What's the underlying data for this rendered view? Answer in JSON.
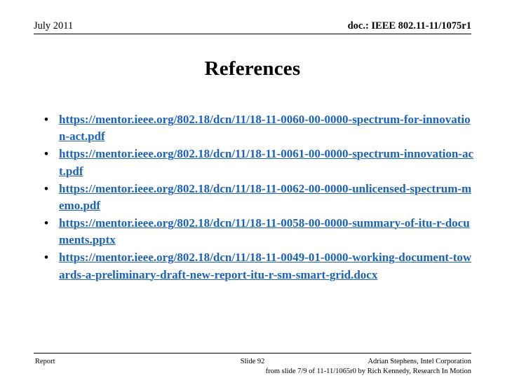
{
  "header": {
    "date": "July 2011",
    "doc": "doc.: IEEE 802.11-11/1075r1"
  },
  "title": "References",
  "bullets": [
    {
      "marker": "•",
      "link": "https://mentor.ieee.org/802.18/dcn/11/18-11-0060-00-0000-spectrum-for-innovation-act.pdf"
    },
    {
      "marker": "•",
      "link": "https://mentor.ieee.org/802.18/dcn/11/18-11-0061-00-0000-spectrum-innovation-act.pdf"
    },
    {
      "marker": "•",
      "link": "https://mentor.ieee.org/802.18/dcn/11/18-11-0062-00-0000-unlicensed-spectrum-memo.pdf"
    },
    {
      "marker": "•",
      "link": "https://mentor.ieee.org/802.18/dcn/11/18-11-0058-00-0000-summary-of-itu-r-documents.pptx"
    },
    {
      "marker": "•",
      "link": "https://mentor.ieee.org/802.18/dcn/11/18-11-0049-01-0000-working-document-towards-a-preliminary-draft-new-report-itu-r-sm-smart-grid.docx"
    }
  ],
  "footer": {
    "left": "Report",
    "center": "Slide 92",
    "right": "Adrian Stephens, Intel Corporation",
    "note": "from slide 7/9 of 11-11/1065r0 by Rich Kennedy, Research In Motion"
  },
  "colors": {
    "link": "#1b62bd",
    "text": "#000000",
    "background": "#ffffff"
  }
}
